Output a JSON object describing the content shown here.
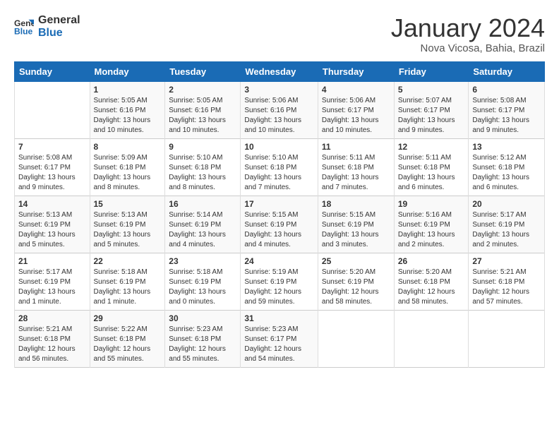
{
  "logo": {
    "line1": "General",
    "line2": "Blue"
  },
  "title": "January 2024",
  "location": "Nova Vicosa, Bahia, Brazil",
  "days_of_week": [
    "Sunday",
    "Monday",
    "Tuesday",
    "Wednesday",
    "Thursday",
    "Friday",
    "Saturday"
  ],
  "weeks": [
    [
      {
        "day": "",
        "info": ""
      },
      {
        "day": "1",
        "info": "Sunrise: 5:05 AM\nSunset: 6:16 PM\nDaylight: 13 hours\nand 10 minutes."
      },
      {
        "day": "2",
        "info": "Sunrise: 5:05 AM\nSunset: 6:16 PM\nDaylight: 13 hours\nand 10 minutes."
      },
      {
        "day": "3",
        "info": "Sunrise: 5:06 AM\nSunset: 6:16 PM\nDaylight: 13 hours\nand 10 minutes."
      },
      {
        "day": "4",
        "info": "Sunrise: 5:06 AM\nSunset: 6:17 PM\nDaylight: 13 hours\nand 10 minutes."
      },
      {
        "day": "5",
        "info": "Sunrise: 5:07 AM\nSunset: 6:17 PM\nDaylight: 13 hours\nand 9 minutes."
      },
      {
        "day": "6",
        "info": "Sunrise: 5:08 AM\nSunset: 6:17 PM\nDaylight: 13 hours\nand 9 minutes."
      }
    ],
    [
      {
        "day": "7",
        "info": "Sunrise: 5:08 AM\nSunset: 6:17 PM\nDaylight: 13 hours\nand 9 minutes."
      },
      {
        "day": "8",
        "info": "Sunrise: 5:09 AM\nSunset: 6:18 PM\nDaylight: 13 hours\nand 8 minutes."
      },
      {
        "day": "9",
        "info": "Sunrise: 5:10 AM\nSunset: 6:18 PM\nDaylight: 13 hours\nand 8 minutes."
      },
      {
        "day": "10",
        "info": "Sunrise: 5:10 AM\nSunset: 6:18 PM\nDaylight: 13 hours\nand 7 minutes."
      },
      {
        "day": "11",
        "info": "Sunrise: 5:11 AM\nSunset: 6:18 PM\nDaylight: 13 hours\nand 7 minutes."
      },
      {
        "day": "12",
        "info": "Sunrise: 5:11 AM\nSunset: 6:18 PM\nDaylight: 13 hours\nand 6 minutes."
      },
      {
        "day": "13",
        "info": "Sunrise: 5:12 AM\nSunset: 6:18 PM\nDaylight: 13 hours\nand 6 minutes."
      }
    ],
    [
      {
        "day": "14",
        "info": "Sunrise: 5:13 AM\nSunset: 6:19 PM\nDaylight: 13 hours\nand 5 minutes."
      },
      {
        "day": "15",
        "info": "Sunrise: 5:13 AM\nSunset: 6:19 PM\nDaylight: 13 hours\nand 5 minutes."
      },
      {
        "day": "16",
        "info": "Sunrise: 5:14 AM\nSunset: 6:19 PM\nDaylight: 13 hours\nand 4 minutes."
      },
      {
        "day": "17",
        "info": "Sunrise: 5:15 AM\nSunset: 6:19 PM\nDaylight: 13 hours\nand 4 minutes."
      },
      {
        "day": "18",
        "info": "Sunrise: 5:15 AM\nSunset: 6:19 PM\nDaylight: 13 hours\nand 3 minutes."
      },
      {
        "day": "19",
        "info": "Sunrise: 5:16 AM\nSunset: 6:19 PM\nDaylight: 13 hours\nand 2 minutes."
      },
      {
        "day": "20",
        "info": "Sunrise: 5:17 AM\nSunset: 6:19 PM\nDaylight: 13 hours\nand 2 minutes."
      }
    ],
    [
      {
        "day": "21",
        "info": "Sunrise: 5:17 AM\nSunset: 6:19 PM\nDaylight: 13 hours\nand 1 minute."
      },
      {
        "day": "22",
        "info": "Sunrise: 5:18 AM\nSunset: 6:19 PM\nDaylight: 13 hours\nand 1 minute."
      },
      {
        "day": "23",
        "info": "Sunrise: 5:18 AM\nSunset: 6:19 PM\nDaylight: 13 hours\nand 0 minutes."
      },
      {
        "day": "24",
        "info": "Sunrise: 5:19 AM\nSunset: 6:19 PM\nDaylight: 12 hours\nand 59 minutes."
      },
      {
        "day": "25",
        "info": "Sunrise: 5:20 AM\nSunset: 6:19 PM\nDaylight: 12 hours\nand 58 minutes."
      },
      {
        "day": "26",
        "info": "Sunrise: 5:20 AM\nSunset: 6:18 PM\nDaylight: 12 hours\nand 58 minutes."
      },
      {
        "day": "27",
        "info": "Sunrise: 5:21 AM\nSunset: 6:18 PM\nDaylight: 12 hours\nand 57 minutes."
      }
    ],
    [
      {
        "day": "28",
        "info": "Sunrise: 5:21 AM\nSunset: 6:18 PM\nDaylight: 12 hours\nand 56 minutes."
      },
      {
        "day": "29",
        "info": "Sunrise: 5:22 AM\nSunset: 6:18 PM\nDaylight: 12 hours\nand 55 minutes."
      },
      {
        "day": "30",
        "info": "Sunrise: 5:23 AM\nSunset: 6:18 PM\nDaylight: 12 hours\nand 55 minutes."
      },
      {
        "day": "31",
        "info": "Sunrise: 5:23 AM\nSunset: 6:17 PM\nDaylight: 12 hours\nand 54 minutes."
      },
      {
        "day": "",
        "info": ""
      },
      {
        "day": "",
        "info": ""
      },
      {
        "day": "",
        "info": ""
      }
    ]
  ]
}
